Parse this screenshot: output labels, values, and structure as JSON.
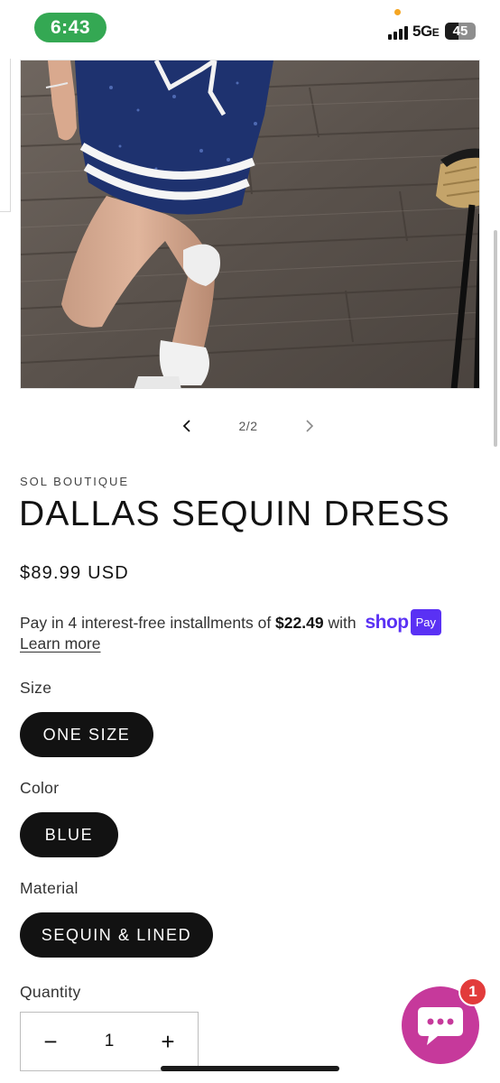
{
  "status_bar": {
    "time": "6:43",
    "network_main": "5G",
    "network_suffix": "E",
    "battery_level": "45",
    "battery_fraction": 0.45
  },
  "gallery": {
    "counter": "2/2",
    "prev_icon": "chevron-left-icon",
    "next_icon": "chevron-right-icon"
  },
  "product": {
    "vendor": "SOL BOUTIQUE",
    "title": "DALLAS SEQUIN DRESS",
    "price": "$89.99 USD"
  },
  "installments": {
    "text_before": "Pay in 4 interest-free installments of ",
    "amount": "$22.49",
    "text_after": " with ",
    "shop_logo": "shop",
    "pay_badge": "Pay",
    "learn_more": "Learn more"
  },
  "options": {
    "size_label": "Size",
    "size_value": "ONE SIZE",
    "color_label": "Color",
    "color_value": "BLUE",
    "material_label": "Material",
    "material_value": "SEQUIN & LINED"
  },
  "quantity": {
    "label": "Quantity",
    "value": "1",
    "minus": "−",
    "plus": "+"
  },
  "chat": {
    "badge_count": "1",
    "icon": "chat-bubble-icon"
  },
  "colors": {
    "accent_button": "#121212",
    "shop_pay": "#5a31f4",
    "chat_button": "#c6399b",
    "badge": "#e23b3b",
    "time_pill": "#34a853"
  }
}
